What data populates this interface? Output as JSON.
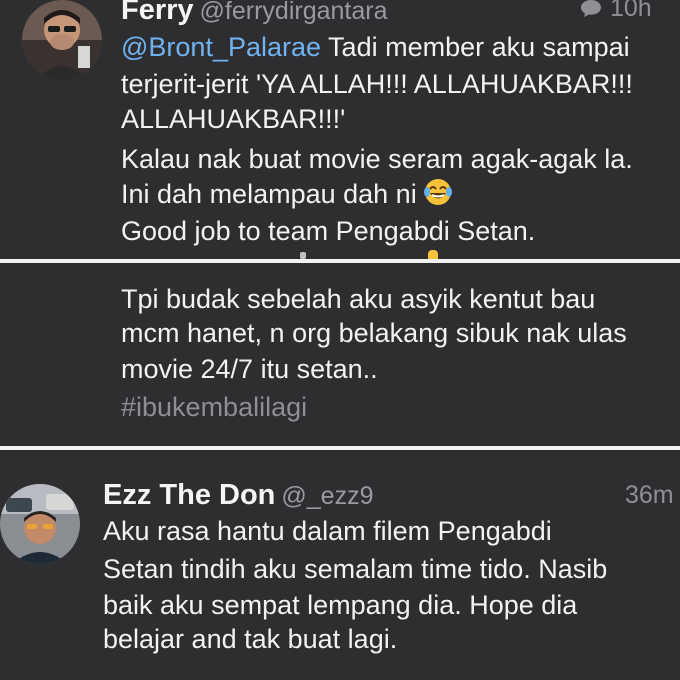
{
  "tweet1": {
    "name": "Ferry",
    "handle": "@ferrydirgantara",
    "time": "10h",
    "reply_icon": "speech-bubble-icon",
    "mention": "@Bront_Palarae",
    "line1_rest": "Tadi member aku sampai",
    "line2": "terjerit-jerit 'YA ALLAH!!! ALLAHUAKBAR!!!",
    "line3": "ALLAHUAKBAR!!!'",
    "line4": "Kalau nak buat movie seram agak-agak la.",
    "line5": "Ini dah melampau dah ni",
    "line5_emoji": "face-with-tears-of-joy-icon",
    "line6": "Good job to team Pengabdi Setan."
  },
  "tweet2": {
    "line1": "Tpi budak sebelah aku asyik kentut bau",
    "line2": "mcm hanet, n org belakang sibuk nak ulas",
    "line3": "movie 24/7 itu setan..",
    "hashtag": "#ibukembalilagi"
  },
  "tweet3": {
    "name": "Ezz The Don",
    "handle": "@_ezz9",
    "time": "36m",
    "line1": "Aku rasa hantu dalam filem Pengabdi",
    "line2": "Setan tindih aku semalam time tido. Nasib",
    "line3": "baik aku sempat lempang dia. Hope dia",
    "line4": "belajar and tak buat lagi."
  },
  "colors": {
    "background": "#2e2e31",
    "divider": "#f2f2f2",
    "mention": "#6fb3f2",
    "muted": "#8e8e94"
  }
}
